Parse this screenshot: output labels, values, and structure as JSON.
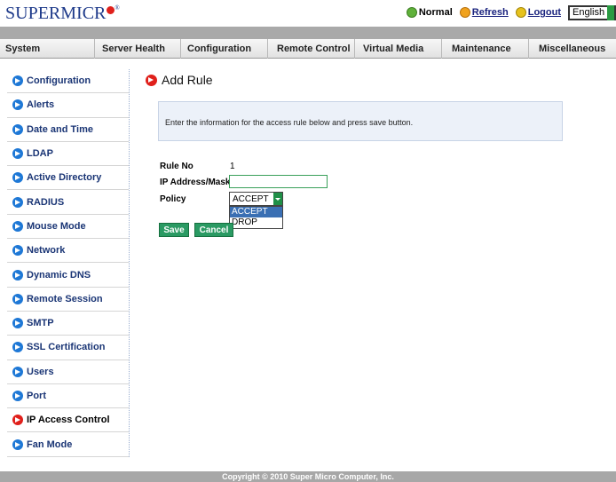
{
  "header": {
    "logo_text": "SUPERMICR",
    "logo_reg": "®",
    "status_label": "Normal",
    "refresh_label": "Refresh",
    "logout_label": "Logout",
    "language_value": "English"
  },
  "menu": {
    "items": [
      "System",
      "Server Health",
      "Configuration",
      "Remote Control",
      "Virtual Media",
      "Maintenance",
      "Miscellaneous"
    ]
  },
  "sidebar": {
    "items": [
      "Configuration",
      "Alerts",
      "Date and Time",
      "LDAP",
      "Active Directory",
      "RADIUS",
      "Mouse Mode",
      "Network",
      "Dynamic DNS",
      "Remote Session",
      "SMTP",
      "SSL Certification",
      "Users",
      "Port",
      "IP Access Control",
      "Fan Mode"
    ],
    "active_item": "IP Access Control"
  },
  "main": {
    "title": "Add Rule",
    "info_text": "Enter the information for the access rule below and press save button.",
    "rule_no_label": "Rule No",
    "rule_no_value": "1",
    "ip_label": "IP Address/Mask",
    "ip_value": "",
    "policy_label": "Policy",
    "policy_selected": "ACCEPT",
    "policy_options": [
      "ACCEPT",
      "DROP"
    ],
    "save_label": "Save",
    "cancel_label": "Cancel"
  },
  "footer": {
    "copyright": "Copyright © 2010 Super Micro Computer, Inc."
  },
  "colors": {
    "menu_text": "#222222",
    "sidebar_link": "#1a3575",
    "button_green": "#2a9a63",
    "arrow_blue": "#1e78d6",
    "arrow_red": "#e0201b"
  }
}
